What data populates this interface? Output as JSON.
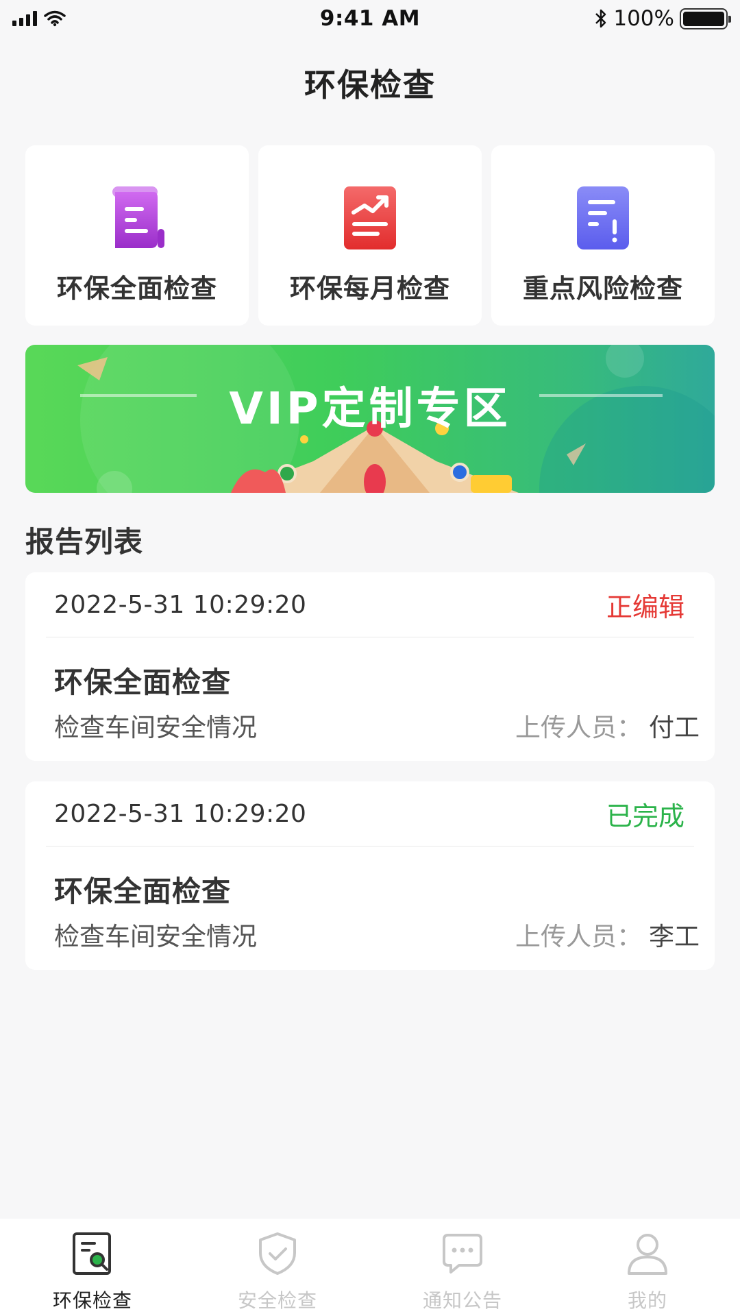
{
  "status_bar": {
    "time": "9:41 AM",
    "battery": "100%"
  },
  "header": {
    "title": "环保检查"
  },
  "quick_actions": [
    {
      "label": "环保全面检查",
      "icon": "document-scroll-icon",
      "color": "#a43bd8"
    },
    {
      "label": "环保每月检查",
      "icon": "trend-chart-icon",
      "color": "#ee4747"
    },
    {
      "label": "重点风险检查",
      "icon": "alert-document-icon",
      "color": "#6a6cf2"
    }
  ],
  "banner": {
    "title": "VIP定制专区"
  },
  "reports": {
    "section_title": "报告列表",
    "items": [
      {
        "date": "2022-5-31 10:29:20",
        "status": "正编辑",
        "status_color": "#e53935",
        "title": "环保全面检查",
        "description": "检查车间安全情况",
        "uploader_label": "上传人员：",
        "uploader": "付工"
      },
      {
        "date": "2022-5-31 10:29:20",
        "status": "已完成",
        "status_color": "#2bb34a",
        "title": "环保全面检查",
        "description": "检查车间安全情况",
        "uploader_label": "上传人员：",
        "uploader": "李工"
      }
    ]
  },
  "tabbar": [
    {
      "label": "环保检查",
      "icon": "inspection-icon",
      "active": true
    },
    {
      "label": "安全检查",
      "icon": "shield-check-icon",
      "active": false
    },
    {
      "label": "通知公告",
      "icon": "message-icon",
      "active": false
    },
    {
      "label": "我的",
      "icon": "user-icon",
      "active": false
    }
  ]
}
